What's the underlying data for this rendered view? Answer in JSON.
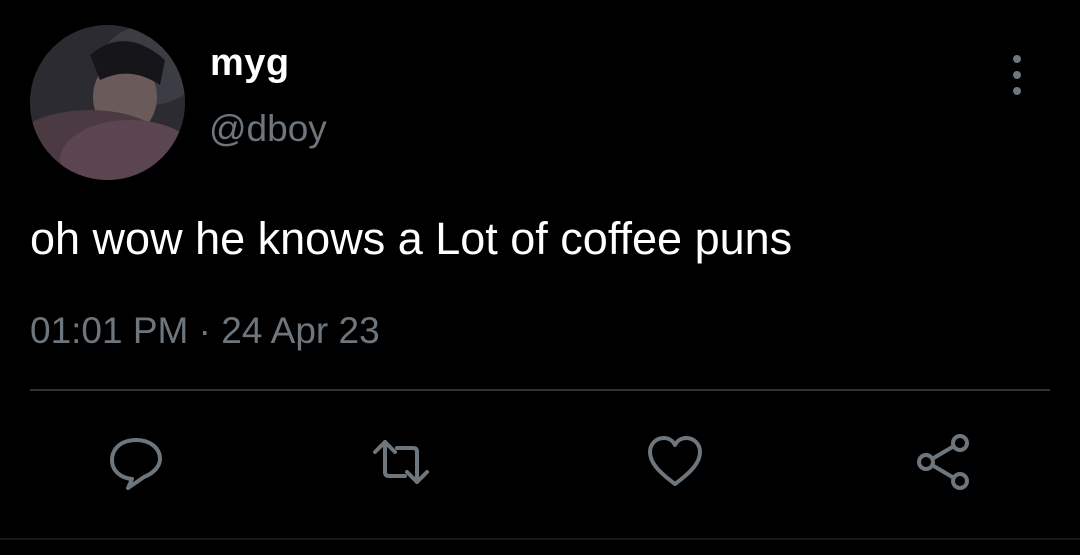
{
  "author": {
    "display_name": "myg",
    "handle": "@dboy",
    "avatar_icon": "profile-photo"
  },
  "tweet": {
    "text": "oh wow he knows a Lot of coffee puns",
    "time": "01:01 PM",
    "separator": " · ",
    "date": "24 Apr 23"
  },
  "actions": {
    "icons": [
      "reply-icon",
      "retweet-icon",
      "like-icon",
      "share-icon"
    ]
  },
  "colors": {
    "background": "#000000",
    "primary_text": "#ffffff",
    "secondary_text": "#6e767d",
    "divider": "#2f3336"
  }
}
